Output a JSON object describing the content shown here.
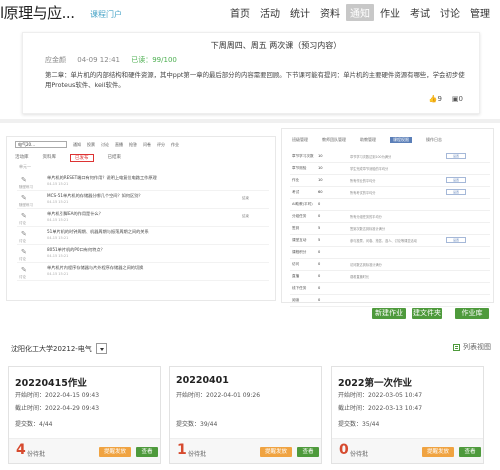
{
  "header": {
    "brand": "l原理与应...",
    "portal": "课程门户",
    "nav": [
      {
        "label": "首页",
        "active": false
      },
      {
        "label": "活动",
        "active": false
      },
      {
        "label": "统计",
        "active": false
      },
      {
        "label": "资料",
        "active": false
      },
      {
        "label": "通知",
        "active": true
      },
      {
        "label": "作业",
        "active": false
      },
      {
        "label": "考试",
        "active": false
      },
      {
        "label": "讨论",
        "active": false
      },
      {
        "label": "管理",
        "active": false
      }
    ]
  },
  "notice": {
    "title": "下周周四、周五 两次课（预习内容）",
    "author": "应金颜",
    "time": "04-09 12:41",
    "read": "已读：99/100",
    "body": "第二章：单片机的内部结构和硬件资源，其中ppt第一章的最后部分的内容需要回顾。下节课可能有提问：单片机的主要硬件资源有哪些，学会初步使用Proteus软件、keil软件。",
    "likes": "9",
    "comments": "0"
  },
  "left_shot": {
    "select": "电气20…",
    "toolbar": [
      "通知",
      "投票",
      "讨论",
      "直播",
      "抢答",
      "问卷",
      "评分",
      "作业"
    ],
    "tabs": [
      "活动库",
      "资料库",
      "已发布",
      "已结束"
    ],
    "active_tab": "已发布",
    "sub": "单元一",
    "rows": [
      {
        "icon_label": "随堂练习",
        "text": "单片机的RESET端口有何作用？说明上电复位电路工作原理",
        "date": "04-15 15:21",
        "action": ""
      },
      {
        "icon_label": "随堂练习",
        "text": "MCS-51单片机的存储器分哪几个空间？如何区别？",
        "date": "04-15 15:21",
        "action": "结束"
      },
      {
        "icon_label": "讨论",
        "text": "单片机引脚EA的作用是什么？",
        "date": "04-15 15:21",
        "action": "结束"
      },
      {
        "icon_label": "讨论",
        "text": "51单片机的时钟周期、机器周期与振荡周期之间的关系",
        "date": "04-15 15:21",
        "action": ""
      },
      {
        "icon_label": "讨论",
        "text": "8051单片机的P0口有何特点？",
        "date": "04-15 15:21",
        "action": ""
      },
      {
        "icon_label": "讨论",
        "text": "单片机片内程序存储器与片外程序存储器之间的切换",
        "date": "04-15 15:21",
        "action": ""
      }
    ]
  },
  "right_shot": {
    "tabs": [
      "班级管理",
      "教师团队管理",
      "助教管理",
      "课程权限",
      "操作日志"
    ],
    "active_tab": "课程权限",
    "rows": [
      {
        "label": "章节学习次数",
        "val": "10",
        "desc": "章节学习次数达到100为满分",
        "btn": "设置"
      },
      {
        "label": "章节测验",
        "val": "10",
        "desc": "学生完成章节测验的平均分",
        "btn": ""
      },
      {
        "label": "作业",
        "val": "10",
        "desc": "所有作业的平均分",
        "btn": "设置"
      },
      {
        "label": "考试",
        "val": "60",
        "desc": "所有考试的平均分",
        "btn": "设置"
      },
      {
        "label": "AI助教(平时)",
        "val": "0",
        "desc": "",
        "btn": ""
      },
      {
        "label": "分组任务",
        "val": "0",
        "desc": "所有分组任务的平均分",
        "btn": ""
      },
      {
        "label": "签到",
        "val": "5",
        "desc": "签到次数达到标准计满分",
        "btn": ""
      },
      {
        "label": "课堂互动",
        "val": "5",
        "desc": "参与投票、问卷、抢答、选人、讨论等课堂活动",
        "btn": "设置"
      },
      {
        "label": "课程积分",
        "val": "0",
        "desc": "",
        "btn": ""
      },
      {
        "label": "访问",
        "val": "0",
        "desc": "访问数达到标准计满分",
        "btn": ""
      },
      {
        "label": "直播",
        "val": "0",
        "desc": "观看直播时长",
        "btn": ""
      },
      {
        "label": "线下任务",
        "val": "0",
        "desc": "",
        "btn": ""
      },
      {
        "label": "阅读",
        "val": "0",
        "desc": "",
        "btn": ""
      }
    ]
  },
  "actions": {
    "new_homework": "新建作业",
    "new_folder": "建文件夹",
    "homework_lib": "作业库"
  },
  "class_select": "沈阳化工大学20212-电气",
  "list_view": "列表视图",
  "cards": [
    {
      "title": "20220415作业",
      "start": "开始时间：2022-04-15 09:43",
      "end": "截止时间：2022-04-29 09:43",
      "submitted": "提交数：4/44",
      "pending": "4",
      "pending_label": "份待批",
      "remind": "提醒发放",
      "view": "查看"
    },
    {
      "title": "20220401",
      "start": "开始时间：2022-04-01 09:26",
      "end": "",
      "submitted": "提交数：39/44",
      "pending": "1",
      "pending_label": "份待批",
      "remind": "提醒发放",
      "view": "查看"
    },
    {
      "title": "2022第一次作业",
      "start": "开始时间：2022-03-05 10:47",
      "end": "截止时间：2022-03-13 10:47",
      "submitted": "提交数：35/44",
      "pending": "0",
      "pending_label": "份待批",
      "remind": "提醒发放",
      "view": "查看"
    }
  ]
}
